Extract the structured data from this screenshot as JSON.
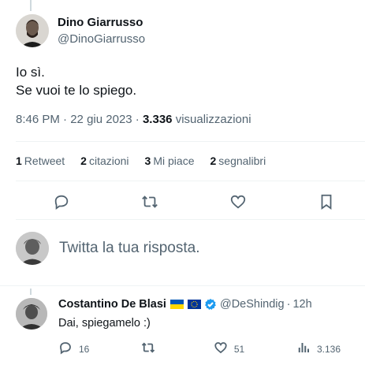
{
  "tweet": {
    "author_name": "Dino Giarrusso",
    "author_handle": "@DinoGiarrusso",
    "text_line1": "Io sì.",
    "text_line2": "Se vuoi te lo spiego.",
    "time": "8:46 PM",
    "date": "22 giu 2023",
    "separator": "·",
    "views_count": "3.336",
    "views_label": "visualizzazioni"
  },
  "stats": {
    "retweets_count": "1",
    "retweets_label": "Retweet",
    "quotes_count": "2",
    "quotes_label": "citazioni",
    "likes_count": "3",
    "likes_label": "Mi piace",
    "bookmarks_count": "2",
    "bookmarks_label": "segnalibri"
  },
  "actions": {
    "icons": [
      "reply-icon",
      "retweet-icon",
      "like-icon",
      "bookmark-icon"
    ]
  },
  "composer": {
    "placeholder": "Twitta la tua risposta."
  },
  "reply": {
    "author_name": "Costantino De Blasi",
    "author_handle": "@DeShindig",
    "separator": "·",
    "time": "12h",
    "text": "Dai, spiegamelo :)",
    "reply_count": "16",
    "retweet_count": "",
    "like_count": "51",
    "views_count": "3.136",
    "flags": [
      "ukraine-flag-icon",
      "eu-flag-icon"
    ]
  },
  "colors": {
    "text_primary": "#0f1419",
    "text_secondary": "#536471",
    "divider": "#eff3f4",
    "verified_blue": "#1d9bf0",
    "flag_blue": "#0057b7",
    "flag_yellow": "#ffd700",
    "eu_blue": "#003399"
  }
}
